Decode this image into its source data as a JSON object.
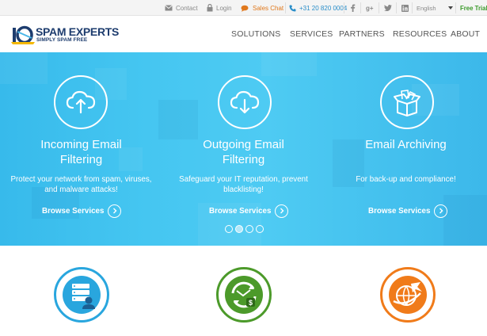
{
  "topbar": {
    "contact": "Contact",
    "login": "Login",
    "sales_chat": "Sales Chat",
    "phone": "+31 20 820 0004",
    "language": "English",
    "free_trial": "Free Trial",
    "social": [
      "facebook-icon",
      "google-plus-icon",
      "twitter-icon",
      "linkedin-icon"
    ]
  },
  "brand": {
    "name": "SPAM EXPERTS",
    "tagline": "SIMPLY SPAM FREE",
    "badge": "10"
  },
  "nav": [
    "SOLUTIONS",
    "SERVICES",
    "PARTNERS",
    "RESOURCES",
    "ABOUT"
  ],
  "hero": {
    "cards": [
      {
        "title": "Incoming Email Filtering",
        "description": "Protect your network from spam, viruses, and malware attacks!",
        "cta": "Browse Services",
        "icon": "cloud-upload-icon"
      },
      {
        "title": "Outgoing Email Filtering",
        "description": "Safeguard your IT reputation, prevent blacklisting!",
        "cta": "Browse Services",
        "icon": "cloud-download-icon"
      },
      {
        "title": "Email Archiving",
        "description": "For back-up and compliance!",
        "cta": "Browse Services",
        "icon": "archive-box-icon"
      }
    ],
    "slides_total": 4,
    "active_slide": 2
  },
  "features": [
    {
      "icon": "server-user-icon",
      "color": "#29a6de"
    },
    {
      "icon": "money-cycle-icon",
      "color": "#4c9a2a"
    },
    {
      "icon": "globe-plane-icon",
      "color": "#f07b1a"
    }
  ],
  "colors": {
    "hero_blue": "#42c3f0",
    "brand_navy": "#1d3c6e",
    "accent_orange": "#e0781c",
    "accent_green": "#3b9a2a",
    "link_blue": "#2a8ec9"
  }
}
